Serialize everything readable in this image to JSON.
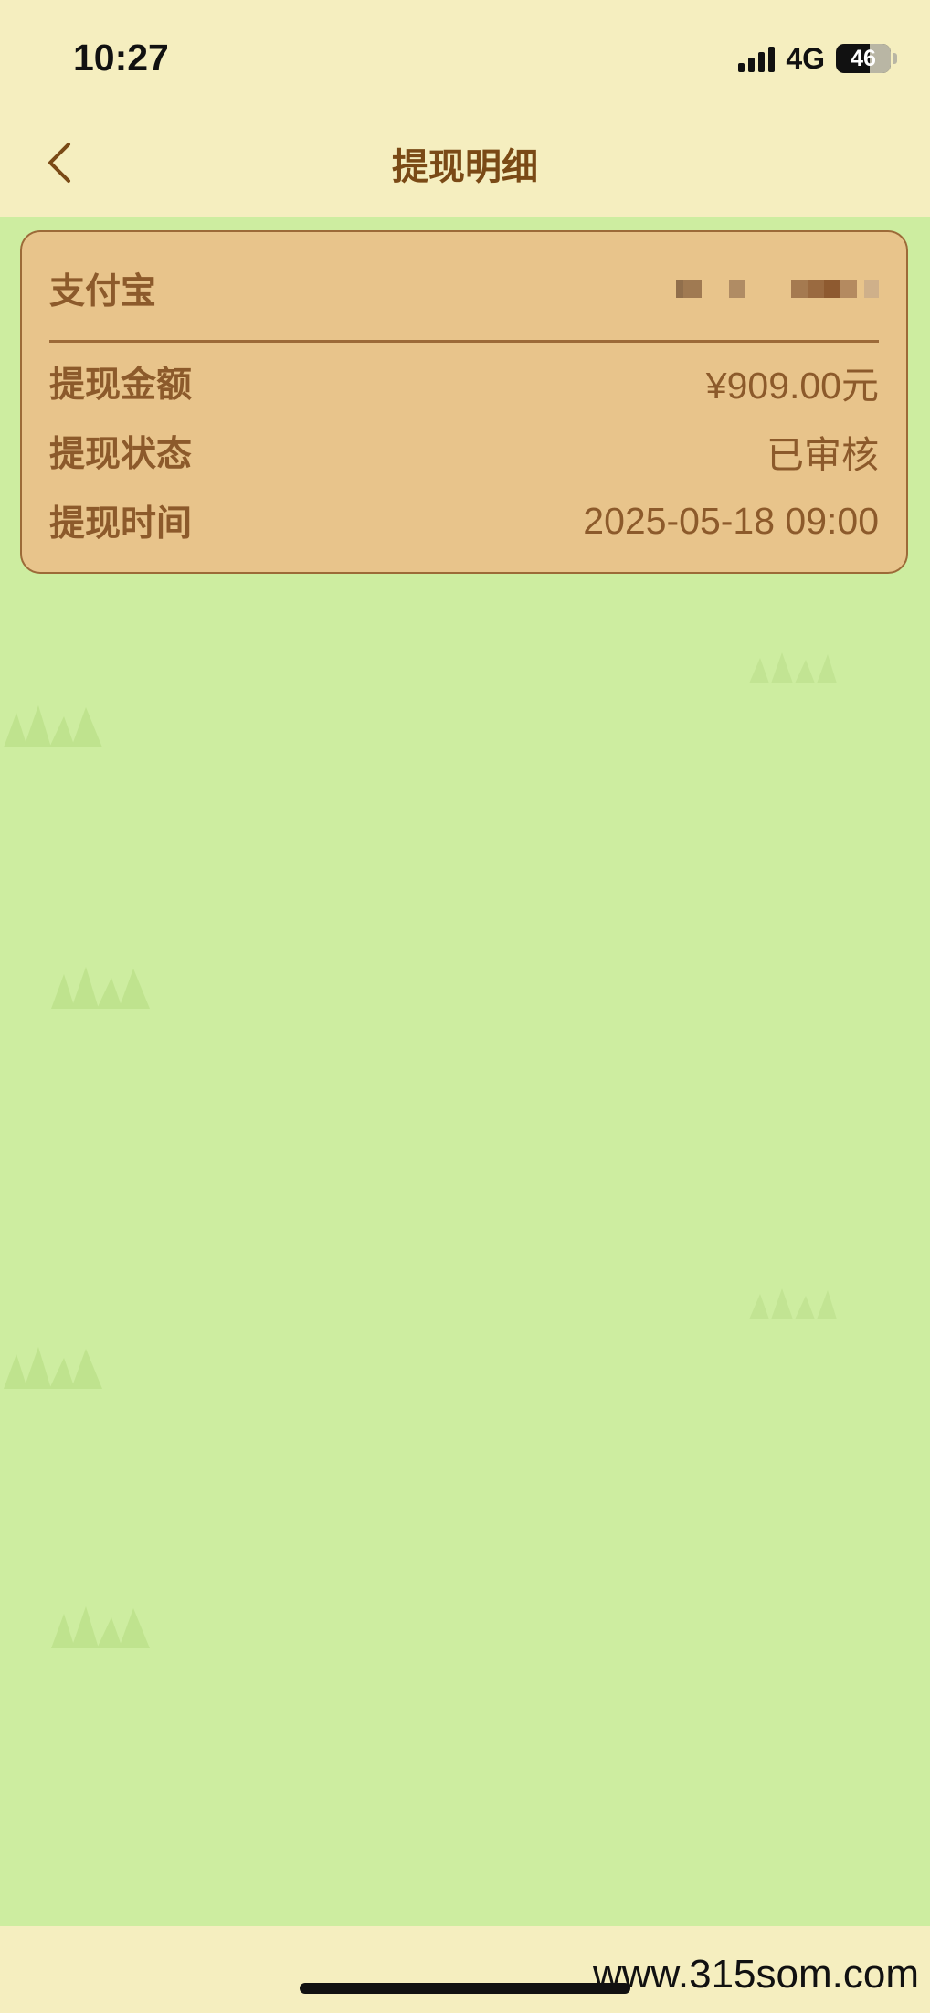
{
  "status_bar": {
    "time": "10:27",
    "network": "4G",
    "battery_level": "46",
    "icons": [
      "signal-icon",
      "battery-icon"
    ]
  },
  "header": {
    "title": "提现明细",
    "back_icon": "chevron-left-icon"
  },
  "card": {
    "account_label": "支付宝",
    "account_value_masked": true,
    "rows": [
      {
        "label": "提现金额",
        "value": "¥909.00元"
      },
      {
        "label": "提现状态",
        "value": "已审核"
      },
      {
        "label": "提现时间",
        "value": "2025-05-18 09:00"
      }
    ]
  },
  "footer": {
    "watermark": "www.315som.com"
  },
  "colors": {
    "page_bg": "#cdeda0",
    "header_bg": "#f5eebf",
    "card_bg": "#e8c48b",
    "card_border": "#9c6a38",
    "text_brown": "#8c5a2b",
    "title_brown": "#7a4a16"
  }
}
